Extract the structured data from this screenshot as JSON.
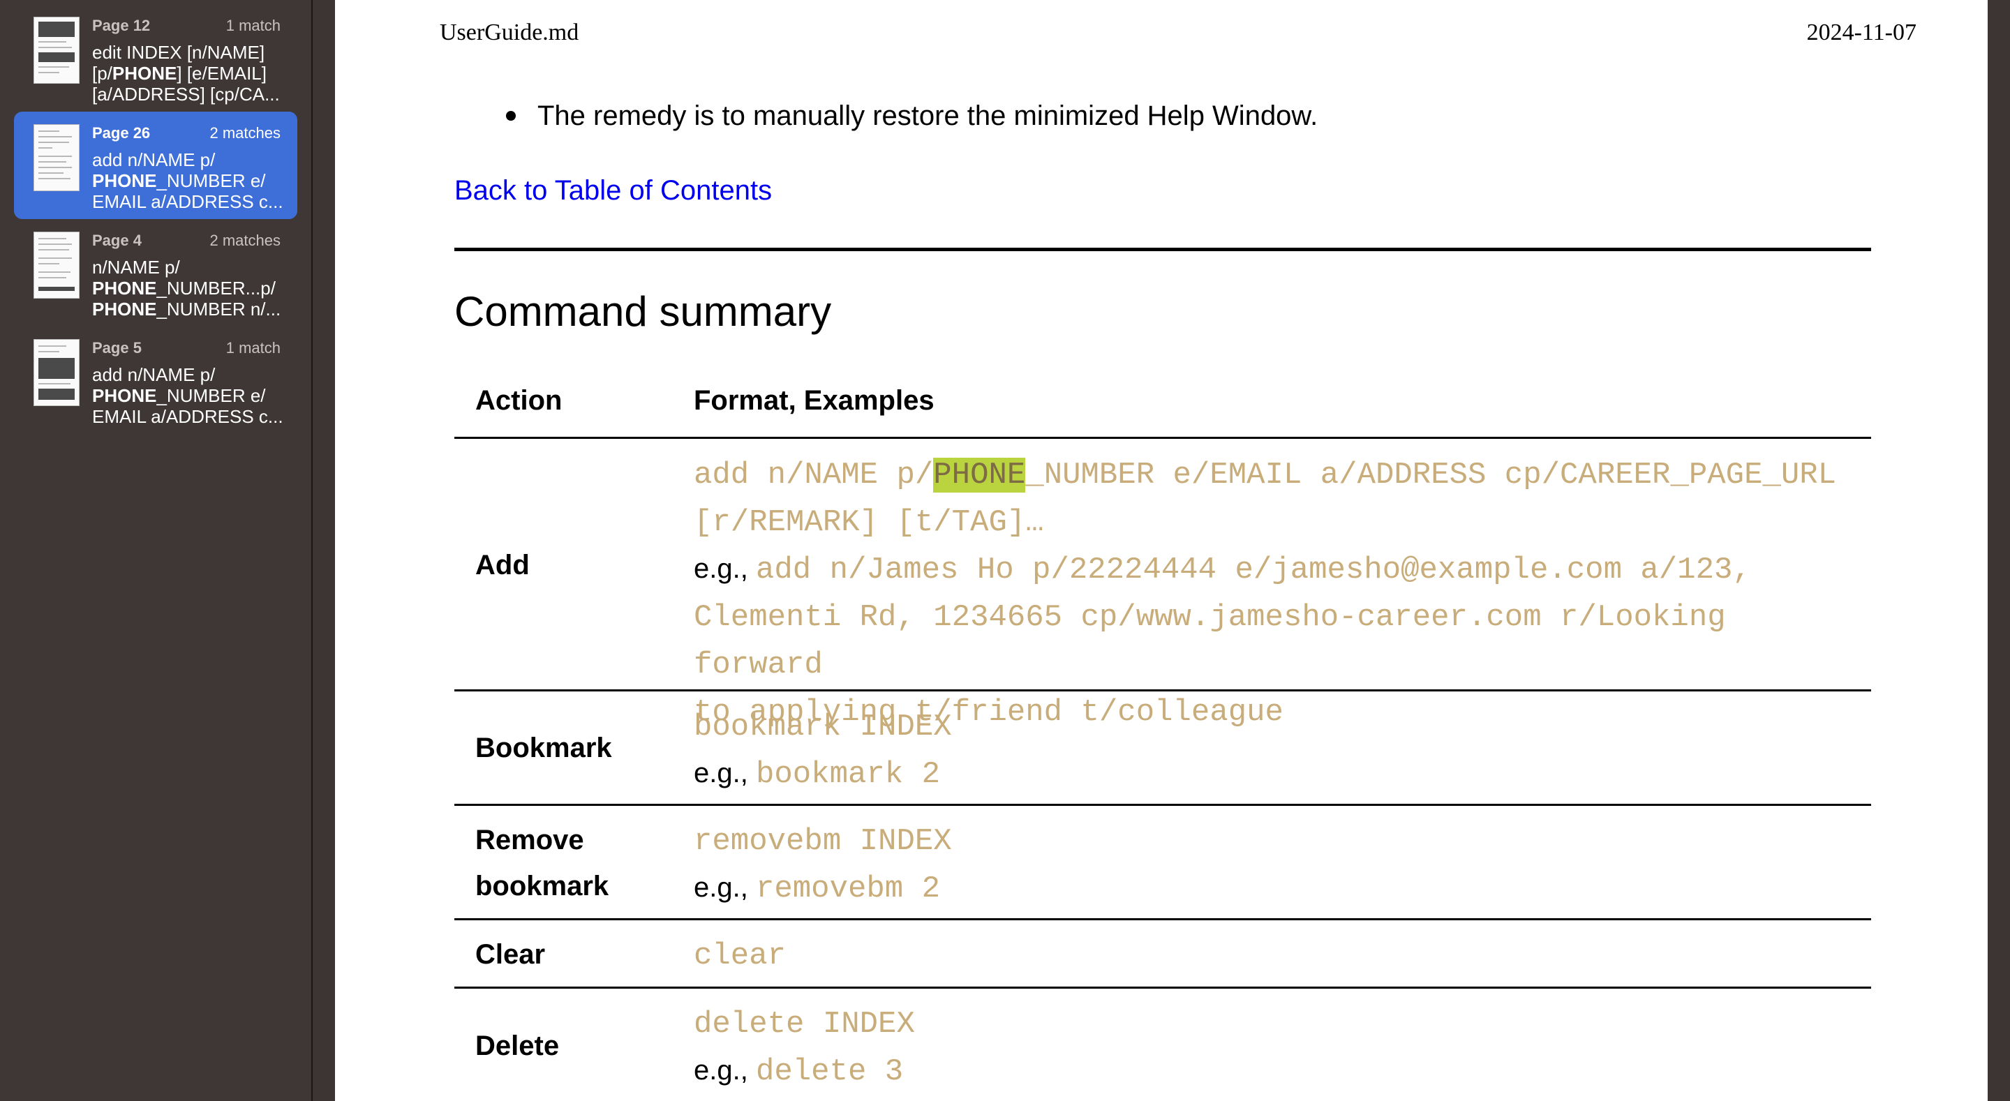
{
  "sidebar": {
    "results": [
      {
        "page": "Page 12",
        "count": "1 match",
        "snippet_html": "edit INDEX [n/NAME]\n[p/<b>PHONE</b>] [e/EMAIL]\n[a/ADDRESS] [cp/CA..."
      },
      {
        "page": "Page 26",
        "count": "2 matches",
        "snippet_html": "add n/NAME p/\n<b>PHONE</b>_NUMBER e/\nEMAIL a/ADDRESS c..."
      },
      {
        "page": "Page 4",
        "count": "2 matches",
        "snippet_html": "n/NAME p/\n<b>PHONE</b>_NUMBER...p/\n<b>PHONE</b>_NUMBER n/..."
      },
      {
        "page": "Page 5",
        "count": "1 match",
        "snippet_html": "add n/NAME p/\n<b>PHONE</b>_NUMBER e/\nEMAIL a/ADDRESS c..."
      }
    ]
  },
  "document": {
    "header_file": "UserGuide.md",
    "header_date": "2024-11-07",
    "bullet": "The remedy is to manually restore the minimized Help Window.",
    "back_link": "Back to Table of Contents",
    "section_title": "Command summary",
    "table": {
      "headers": [
        "Action",
        "Format, Examples"
      ],
      "add": {
        "action": "Add",
        "format_pre": "add n/NAME p/",
        "format_highlight": "PHONE",
        "format_post": "_NUMBER e/EMAIL a/ADDRESS cp/CAREER_PAGE_URL",
        "format_line2": "[r/REMARK] [t/TAG]…",
        "eg": "e.g.,",
        "example_line1": "add n/James Ho p/22224444 e/jamesho@example.com a/123,",
        "example_line2": "Clementi Rd, 1234665 cp/www.jamesho-career.com r/Looking forward",
        "example_line3": "to applying t/friend t/colleague"
      },
      "bookmark": {
        "action": "Bookmark",
        "format": "bookmark INDEX",
        "eg": "e.g.,",
        "example": "bookmark 2"
      },
      "removebm": {
        "action_line1": "Remove",
        "action_line2": "bookmark",
        "format": "removebm INDEX",
        "eg": "e.g.,",
        "example": "removebm 2"
      },
      "clear": {
        "action": "Clear",
        "format": "clear"
      },
      "delete": {
        "action": "Delete",
        "format": "delete INDEX",
        "eg": "e.g.,",
        "example": "delete 3"
      }
    }
  },
  "colors": {
    "code": "#c8ac7a",
    "highlight": "#b9d43e",
    "link": "#0000ee",
    "selected": "#3e6fd8"
  }
}
